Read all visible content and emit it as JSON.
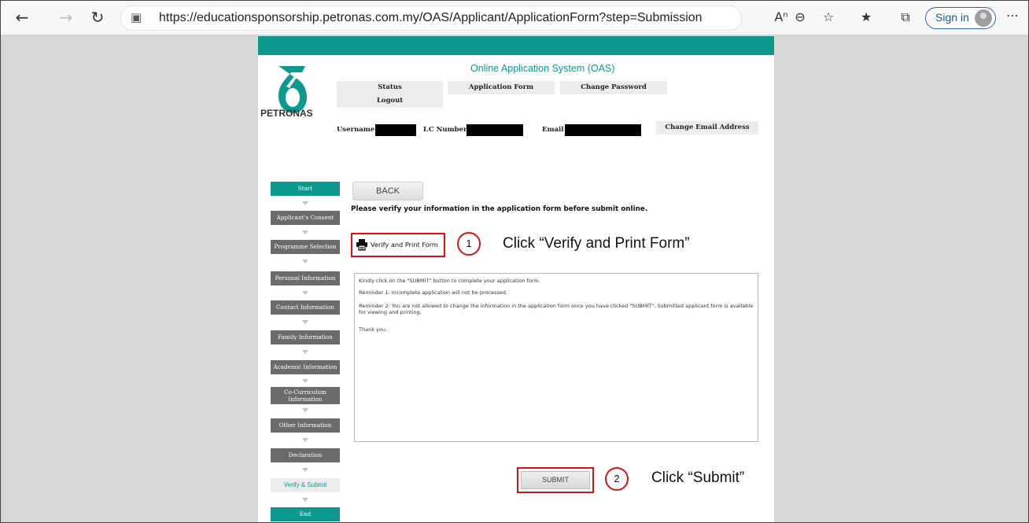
{
  "browser": {
    "url": "https://educationsponsorship.petronas.com.my/OAS/Applicant/ApplicationForm?step=Submission",
    "sign_in_label": "Sign in"
  },
  "header": {
    "logo_text": "PETRONAS",
    "system_title": "Online Application System (OAS)",
    "menu": {
      "status": "Status",
      "application_form": "Application Form",
      "change_password": "Change Password",
      "logout": "Logout"
    },
    "username_label": "Username :",
    "ic_label": "I.C Number :",
    "email_label": "Email :",
    "change_email": "Change Email Address"
  },
  "steps": [
    {
      "label": "Start"
    },
    {
      "label": "Applicant's Consent"
    },
    {
      "label": "Programme Selection"
    },
    {
      "label": "Personal Information"
    },
    {
      "label": "Contact Information"
    },
    {
      "label": "Family Information"
    },
    {
      "label": "Academic Information"
    },
    {
      "label_line1": "Co-Curriculum",
      "label_line2": "Information"
    },
    {
      "label": "Other Information"
    },
    {
      "label": "Declaration"
    },
    {
      "label": "Verify & Submit"
    },
    {
      "label": "End"
    }
  ],
  "main": {
    "back_label": "BACK",
    "verify_message": "Please verify your information in the application form before submit online.",
    "verify_print_label": "Verify and Print Form",
    "notice": {
      "line1": "Kindly click on the \"SUBMIT\" button to complete your application form.",
      "line2": "Reminder 1: Incomplete application will not be processed.",
      "line3": "Reminder 2: You are not allowed to change the information in the application form once you have clicked \"SUBMIT\". Submitted applicant form is available for viewing and printing.",
      "line4": "Thank you."
    },
    "submit_label": "SUBMIT"
  },
  "annotations": {
    "step1_number": "1",
    "step1_text": "Click “Verify and Print Form”",
    "step2_number": "2",
    "step2_text": "Click “Submit”"
  },
  "colors": {
    "brand_teal": "#0d9a8c",
    "step_gray": "#6b6b6b",
    "annotation_red": "#e01010"
  }
}
